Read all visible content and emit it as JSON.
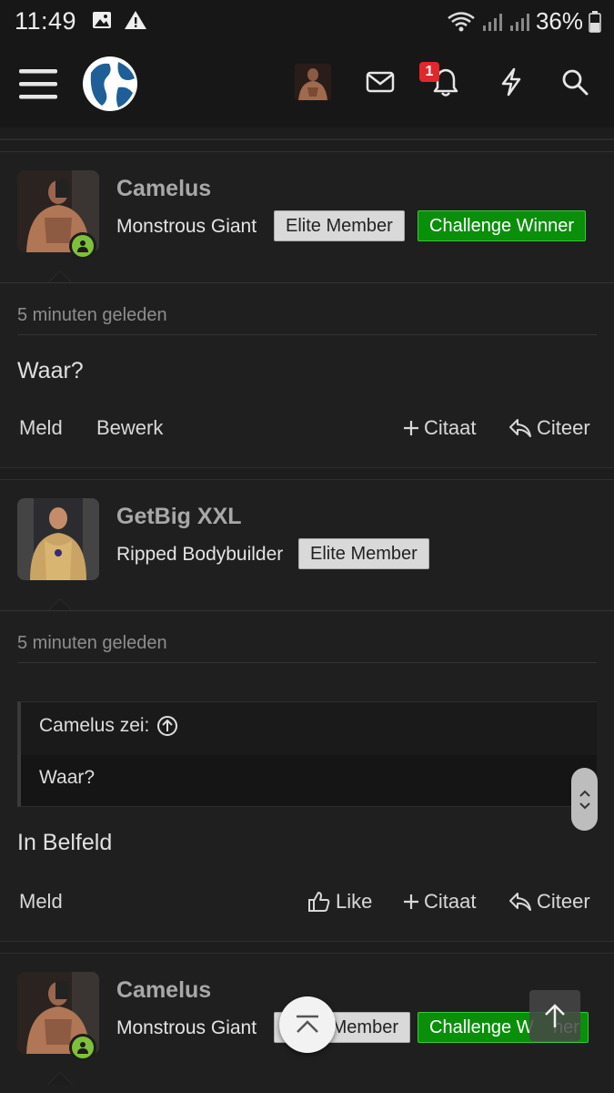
{
  "status_bar": {
    "time": "11:49",
    "battery": "36%"
  },
  "navbar": {
    "notification_count": "1",
    "icons": [
      "menu-icon",
      "site-logo",
      "user-avatar",
      "mail-icon",
      "bell-icon",
      "lightning-icon",
      "search-icon"
    ]
  },
  "colors": {
    "background": "#1d1d1d",
    "banner_green": "#0a8f0a",
    "banner_grey": "#d9d9d9",
    "online": "#7fc03a",
    "badge": "#e0282c"
  },
  "posts": [
    {
      "username": "Camelus",
      "user_title": "Monstrous Giant",
      "banners": [
        "Elite Member",
        "Challenge Winner"
      ],
      "timestamp": "5 minuten geleden",
      "message": "Waar?",
      "actions": {
        "report": "Meld",
        "edit": "Bewerk",
        "multiquote": "Citaat",
        "reply": "Citeer"
      }
    },
    {
      "username": "GetBig XXL",
      "user_title": "Ripped Bodybuilder",
      "banners": [
        "Elite Member"
      ],
      "timestamp": "5 minuten geleden",
      "quote": {
        "author": "Camelus zei:",
        "text": "Waar?"
      },
      "message": "In Belfeld",
      "actions": {
        "report": "Meld",
        "like": "Like",
        "multiquote": "Citaat",
        "reply": "Citeer"
      }
    },
    {
      "username": "Camelus",
      "user_title": "Monstrous Giant",
      "banners": [
        "Elite Member",
        "Challenge Winner"
      ]
    }
  ],
  "partial_banner_text": "Member",
  "partial_banner_text_2": "Challenge W",
  "partial_banner_text_3": "ner"
}
